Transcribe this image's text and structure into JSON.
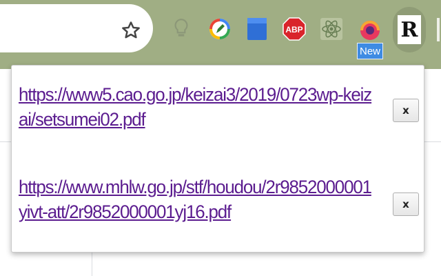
{
  "toolbar": {
    "bookmark_icon": "star-icon",
    "extensions": [
      {
        "name": "lightbulb-icon"
      },
      {
        "name": "clock-pencil-icon"
      },
      {
        "name": "folder-icon"
      },
      {
        "name": "adblock-plus-icon",
        "label": "ABP"
      },
      {
        "name": "react-icon"
      },
      {
        "name": "gauge-icon"
      }
    ],
    "new_badge": "New",
    "profile_letter": "R"
  },
  "popup": {
    "items": [
      {
        "url": "https://www5.cao.go.jp/keizai3/2019/0723wp-keizai/setsumei02.pdf",
        "close_label": "x"
      },
      {
        "url": "https://www.mhlw.go.jp/stf/houdou/2r9852000001yivt-att/2r9852000001yj16.pdf",
        "close_label": "x"
      }
    ]
  },
  "colors": {
    "toolbar_bg": "#a0ae84",
    "link": "#5b1c8f",
    "badge": "#3e8be3",
    "abp_red": "#d9242b"
  }
}
